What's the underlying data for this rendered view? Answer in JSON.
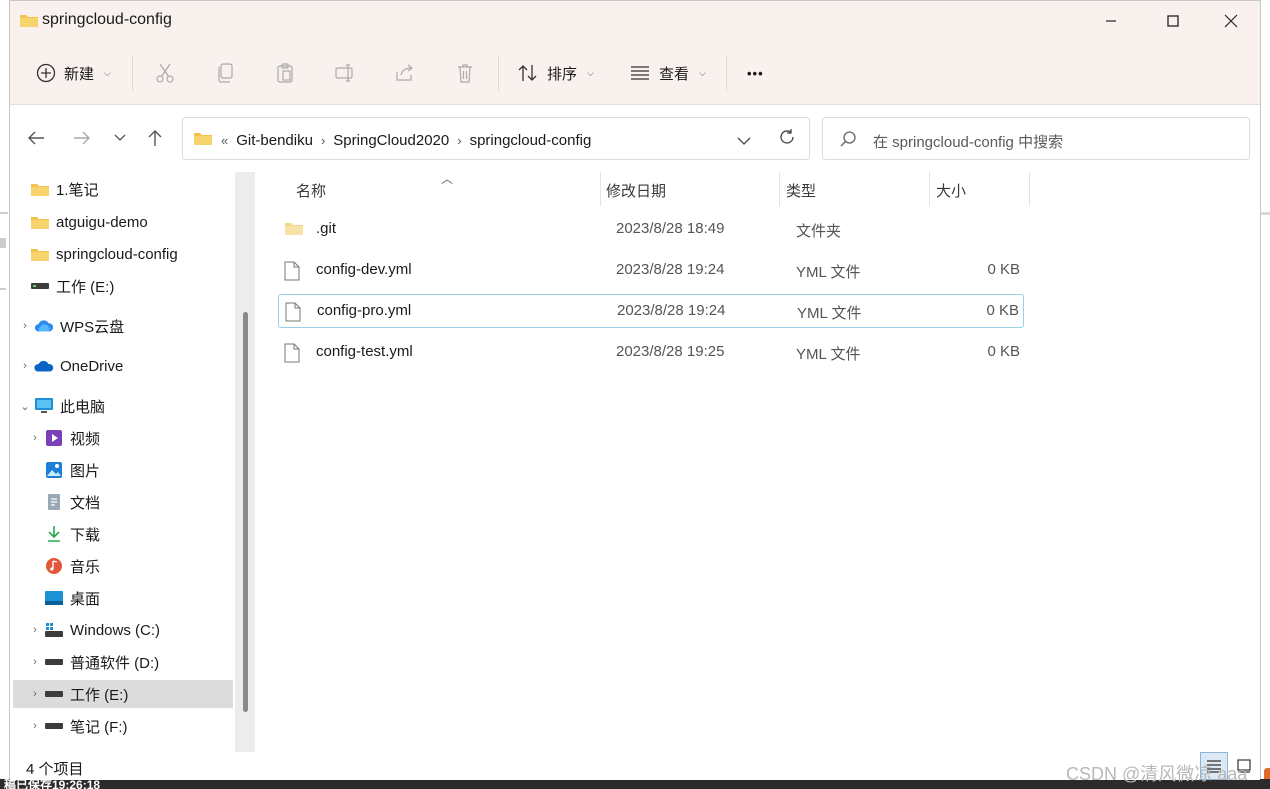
{
  "window": {
    "title": "springcloud-config"
  },
  "toolbar": {
    "new_label": "新建",
    "sort_label": "排序",
    "view_label": "查看",
    "more_label": "•••"
  },
  "address": {
    "overflow": "«",
    "crumbs": [
      "Git-bendiku",
      "SpringCloud2020",
      "springcloud-config"
    ],
    "search_placeholder": "在 springcloud-config 中搜索"
  },
  "sidebar": {
    "items": [
      {
        "label": "1.笔记",
        "icon": "folder-icon"
      },
      {
        "label": "atguigu-demo",
        "icon": "folder-icon"
      },
      {
        "label": "springcloud-config",
        "icon": "folder-icon"
      },
      {
        "label": "工作 (E:)",
        "icon": "drive-icon"
      },
      {
        "label": "WPS云盘",
        "icon": "cloud-icon"
      },
      {
        "label": "OneDrive",
        "icon": "onedrive-icon"
      },
      {
        "label": "此电脑",
        "icon": "computer-icon"
      },
      {
        "label": "视频",
        "icon": "video-icon"
      },
      {
        "label": "图片",
        "icon": "picture-icon"
      },
      {
        "label": "文档",
        "icon": "document-icon"
      },
      {
        "label": "下载",
        "icon": "download-icon"
      },
      {
        "label": "音乐",
        "icon": "music-icon"
      },
      {
        "label": "桌面",
        "icon": "desktop-icon"
      },
      {
        "label": "Windows (C:)",
        "icon": "windows-drive-icon"
      },
      {
        "label": "普通软件 (D:)",
        "icon": "drive-icon"
      },
      {
        "label": "工作 (E:)",
        "icon": "drive-icon"
      },
      {
        "label": "笔记 (F:)",
        "icon": "drive-icon"
      }
    ]
  },
  "columns": {
    "name": "名称",
    "date": "修改日期",
    "type": "类型",
    "size": "大小"
  },
  "files": [
    {
      "name": ".git",
      "date": "2023/8/28 18:49",
      "type": "文件夹",
      "size": "",
      "icon": "folder-icon"
    },
    {
      "name": "config-dev.yml",
      "date": "2023/8/28 19:24",
      "type": "YML 文件",
      "size": "0 KB",
      "icon": "file-icon"
    },
    {
      "name": "config-pro.yml",
      "date": "2023/8/28 19:24",
      "type": "YML 文件",
      "size": "0 KB",
      "icon": "file-icon"
    },
    {
      "name": "config-test.yml",
      "date": "2023/8/28 19:25",
      "type": "YML 文件",
      "size": "0 KB",
      "icon": "file-icon"
    }
  ],
  "status": {
    "count": "4 个项目"
  },
  "watermark": "CSDN @清风微凉 aaa",
  "background": {
    "bottom_text": "稿已保存19:26:18"
  },
  "colors": {
    "titlebar": "#f9f1ee",
    "selection_border": "#99d1e8",
    "folder": "#f2c14e"
  }
}
